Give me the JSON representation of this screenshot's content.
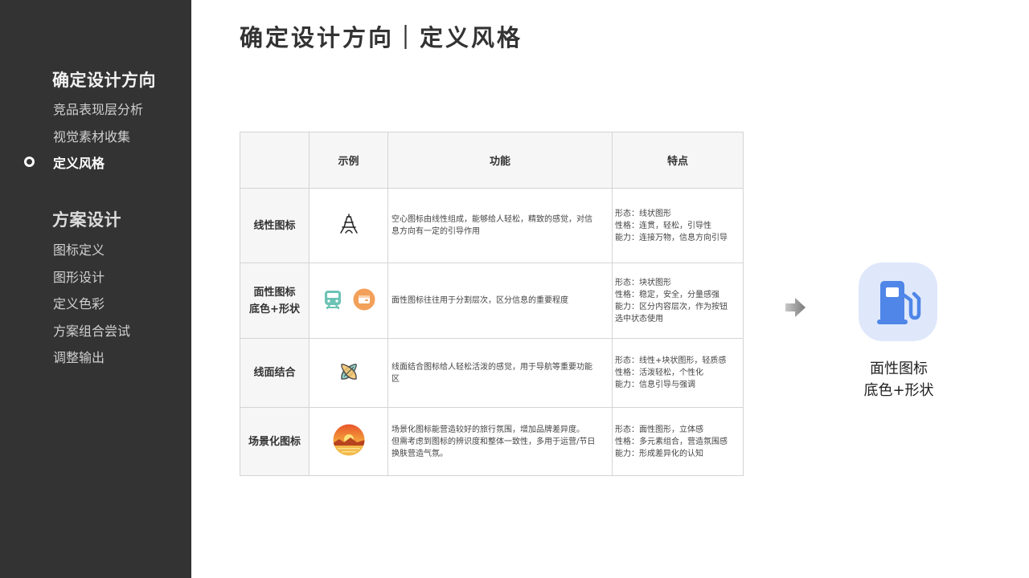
{
  "title": "确定设计方向｜定义风格",
  "sidebar": {
    "section1": {
      "title": "确定设计方向",
      "items": [
        {
          "label": "竞品表现层分析"
        },
        {
          "label": "视觉素材收集"
        },
        {
          "label": "定义风格",
          "active": true
        }
      ]
    },
    "section2": {
      "title": "方案设计",
      "items": [
        {
          "label": "图标定义"
        },
        {
          "label": "图形设计"
        },
        {
          "label": "定义色彩"
        },
        {
          "label": "方案组合尝试"
        },
        {
          "label": "调整输出"
        }
      ]
    }
  },
  "table": {
    "headers": [
      "",
      "示例",
      "功能",
      "特点"
    ],
    "rows": [
      {
        "name": [
          "线性图标"
        ],
        "icons": [
          "eiffel-tower-outline-icon"
        ],
        "function": [
          "空心图标由线性组成，能够给人轻松，精致的感觉，对信",
          "息方向有一定的引导作用"
        ],
        "features": [
          "形态：线状图形",
          "性格：连贯，轻松，引导性",
          "能力：连接万物，信息方向引导"
        ]
      },
      {
        "name": [
          "面性图标",
          "底色+形状"
        ],
        "icons": [
          "train-icon",
          "wallet-icon"
        ],
        "function": [
          "面性图标往往用于分割层次，区分信息的重要程度"
        ],
        "features": [
          "形态：块状图形",
          "性格：稳定，安全，分量感强",
          "能力：区分内容层次，作为按钮",
          "选中状态使用"
        ]
      },
      {
        "name": [
          "线面结合"
        ],
        "icons": [
          "surfboards-icon"
        ],
        "function": [
          "线面结合图标给人轻松活泼的感觉，用于导航等重要功能",
          "区"
        ],
        "features": [
          "形态：线性+块状图形，轻质感",
          "性格：活泼轻松，个性化",
          "能力：信息引导与强调"
        ]
      },
      {
        "name": [
          "场景化图标"
        ],
        "icons": [
          "sunset-scene-icon"
        ],
        "function": [
          "场景化图标能营造较好的旅行氛围，增加品牌差异度。",
          "但需考虑到图标的辨识度和整体一致性，多用于运营/节日",
          "换肤营造气氛。"
        ],
        "features": [
          "形态：面性图形，立体感",
          "性格：多元素组合，营造氛围感",
          "能力：形成差异化的认知"
        ]
      }
    ]
  },
  "result": {
    "icon": "gas-station-icon",
    "caption": [
      "面性图标",
      "底色+形状"
    ],
    "icon_color": "#4f86e8",
    "icon_bg": "#dfe8fb"
  },
  "colors": {
    "sidebar_bg": "#333333",
    "train": "#6cc3b5",
    "wallet": "#f2a05a"
  }
}
